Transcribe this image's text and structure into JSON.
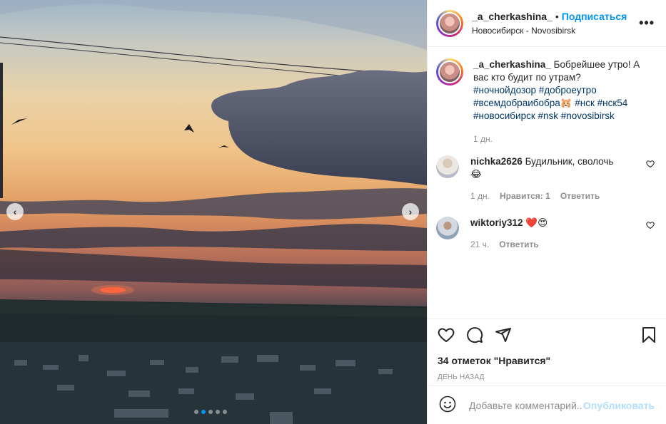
{
  "colors": {
    "accent": "#0095f6",
    "text": "#262626",
    "muted": "#8e8e8e",
    "like_red": "#ed4956",
    "hashtag": "#00376b"
  },
  "header": {
    "username": "_a_cherkashina_",
    "separator": "•",
    "follow_label": "Подписаться",
    "location": "Новосибирск - Novosibirsk",
    "more_icon": "more-horizontal-icon"
  },
  "caption": {
    "username": "_a_cherkashina_",
    "text": "Бобрейшее утро! А вас кто будит по утрам?",
    "hashtags_line1": "#ночнойдозор #доброеутро",
    "hashtags_line2": "#всемдобраибобра🐹 #нск #нск54",
    "hashtags_line3": "#новосибирск #nsk #novosibirsk",
    "time": "1 дн."
  },
  "comments": [
    {
      "username": "nichka2626",
      "text": "Будильник, сволочь",
      "emoji": "😂",
      "time": "1 дн.",
      "likes": "Нравится: 1",
      "reply": "Ответить"
    },
    {
      "username": "wiktoriy312",
      "text": "",
      "emoji": "❤️😍",
      "time": "21 ч.",
      "reply": "Ответить"
    }
  ],
  "carousel": {
    "slide_count": 5,
    "active_index": 1
  },
  "actions": {
    "likes_text": "34 отметок \"Нравится\"",
    "date_text": "День назад"
  },
  "add_comment": {
    "placeholder": "Добавьте комментарий...",
    "publish_label": "Опубликовать"
  }
}
